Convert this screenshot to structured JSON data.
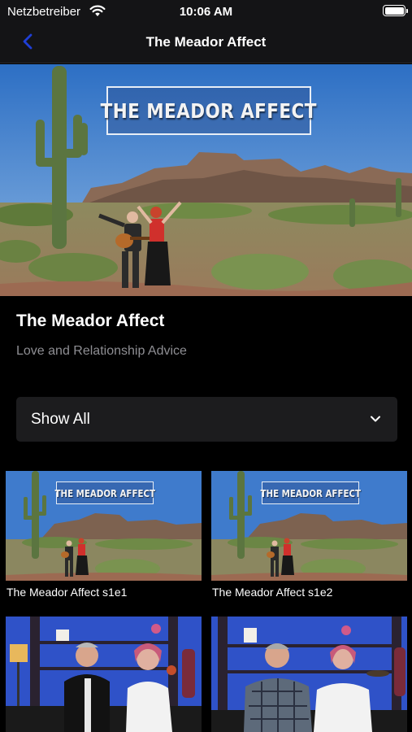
{
  "status_bar": {
    "carrier": "Netzbetreiber",
    "time": "10:06 AM",
    "battery_level": 1.0
  },
  "nav": {
    "title": "The Meador Affect",
    "back_icon": "chevron-left-icon",
    "accent": "#1f3fd6"
  },
  "hero": {
    "banner_text": "THE MEADOR AFFECT"
  },
  "show": {
    "title": "The Meador Affect",
    "subtitle": "Love and Relationship Advice"
  },
  "filter": {
    "selected": "Show All",
    "icon": "chevron-down-icon"
  },
  "episodes": [
    {
      "label": "The Meador Affect s1e1",
      "banner_text": "THE MEADOR AFFECT"
    },
    {
      "label": "The Meador Affect s1e2",
      "banner_text": "THE MEADOR AFFECT"
    },
    {
      "label": "",
      "banner_text": ""
    },
    {
      "label": "",
      "banner_text": ""
    }
  ]
}
